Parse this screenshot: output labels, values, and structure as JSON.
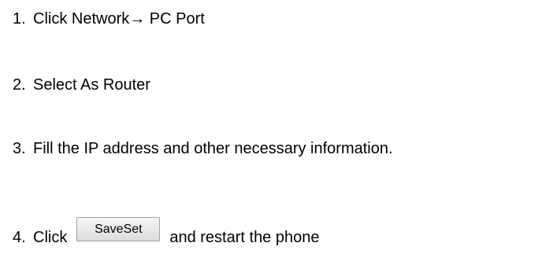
{
  "steps": [
    {
      "number": "1.",
      "text": "Click Network→ PC Port"
    },
    {
      "number": "2.",
      "text": "Select As Router"
    },
    {
      "number": "3.",
      "text": "Fill the IP address and other necessary information."
    },
    {
      "number": "4.",
      "text_before": "Click",
      "button_label": "SaveSet",
      "text_after": "and restart the phone"
    }
  ]
}
